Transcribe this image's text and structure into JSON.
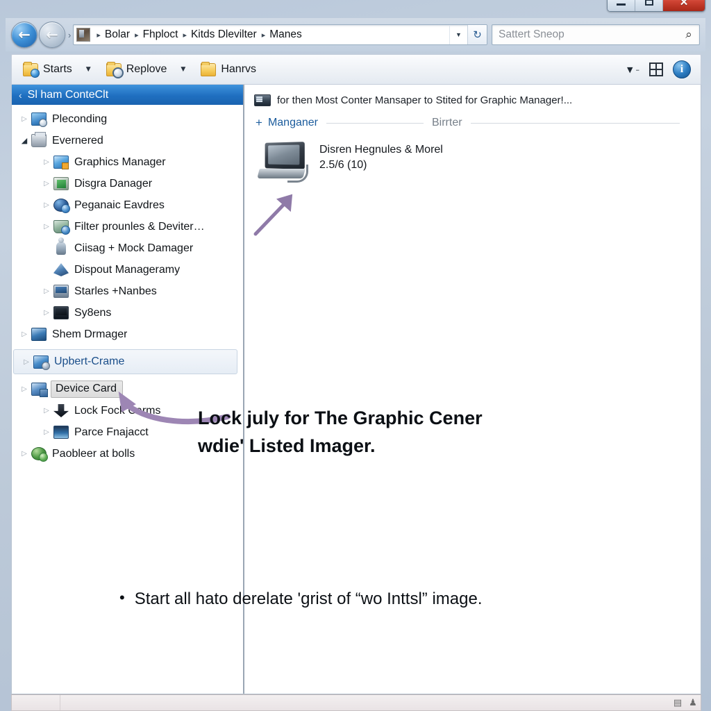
{
  "window": {
    "caption_buttons": [
      {
        "name": "minimize",
        "glyph": ""
      },
      {
        "name": "maximize",
        "glyph": ""
      },
      {
        "name": "close",
        "glyph": "✕"
      }
    ]
  },
  "navbar": {
    "back_arrow": "←",
    "forward_arrow": "←",
    "recent_chevron": "›",
    "breadcrumb": {
      "separator": "▸",
      "crumbs": [
        "Bolar",
        "Fhploct",
        "Kitds Dlevilter",
        "Manes"
      ]
    },
    "dropdown_caret": "▼",
    "refresh_glyph": "↻",
    "search": {
      "placeholder": "Sattert Sneop",
      "value": "",
      "icon": "search-icon",
      "magnifier_glyph": "⌕"
    }
  },
  "toolbar": {
    "items": [
      {
        "label": "Starts",
        "icon": "folder-badge-icon",
        "caret": "▼"
      },
      {
        "label": "Replove",
        "icon": "folder-blue-badge-icon",
        "caret": "▼"
      },
      {
        "label": "Hanrvs",
        "icon": "folder-icon",
        "caret": ""
      }
    ],
    "view_caret": "▼",
    "view_dash": "–",
    "grid_icon": "grid-view-icon",
    "help_icon": "info-icon",
    "help_glyph": "i"
  },
  "sidebar": {
    "header": {
      "chevron": "‹",
      "title": "Sl ham ConteClt"
    },
    "items": [
      {
        "label": "Pleconding",
        "indent": 0,
        "twisty": "▷",
        "expanded": false,
        "icon": "network-icon",
        "state": "normal"
      },
      {
        "label": "Evernered",
        "indent": 0,
        "twisty": "◢",
        "expanded": true,
        "icon": "printer-icon",
        "state": "normal"
      },
      {
        "label": "Graphics Manager",
        "indent": 1,
        "twisty": "▷",
        "expanded": false,
        "icon": "graphics-icon",
        "state": "normal"
      },
      {
        "label": "Disgra Danager",
        "indent": 1,
        "twisty": "▷",
        "expanded": false,
        "icon": "green-card-icon",
        "state": "normal"
      },
      {
        "label": "Peganaic Eavdres",
        "indent": 1,
        "twisty": "▷",
        "expanded": false,
        "icon": "globe-icon",
        "state": "normal"
      },
      {
        "label": "Filter prounles & Deviter…",
        "indent": 1,
        "twisty": "▷",
        "expanded": false,
        "icon": "filter-icon",
        "state": "normal"
      },
      {
        "label": "Ciisag + Mock Damager",
        "indent": 1,
        "twisty": "",
        "expanded": false,
        "icon": "person-icon",
        "state": "normal"
      },
      {
        "label": "Dispout Manageramy",
        "indent": 1,
        "twisty": "",
        "expanded": false,
        "icon": "display-icon",
        "state": "normal"
      },
      {
        "label": "Starles +Nanbes",
        "indent": 1,
        "twisty": "▷",
        "expanded": false,
        "icon": "laptop-icon",
        "state": "normal"
      },
      {
        "label": "Sy8ens",
        "indent": 1,
        "twisty": "▷",
        "expanded": false,
        "icon": "monitor-icon",
        "state": "normal"
      },
      {
        "label": "Shem Drmager",
        "indent": 0,
        "twisty": "▷",
        "expanded": false,
        "icon": "screen-icon",
        "state": "normal"
      },
      {
        "label": "Upbert-Crame",
        "indent": 0,
        "twisty": "▷",
        "expanded": false,
        "icon": "flag-icon",
        "state": "soft-selected"
      },
      {
        "label": "Device Card",
        "indent": 0,
        "twisty": "▷",
        "expanded": true,
        "icon": "device-card-icon",
        "state": "selected"
      },
      {
        "label": "Lock Fock Carms",
        "indent": 1,
        "twisty": "▷",
        "expanded": false,
        "icon": "download-icon",
        "state": "normal"
      },
      {
        "label": "Parce Fnajacct",
        "indent": 1,
        "twisty": "▷",
        "expanded": false,
        "icon": "picture-icon",
        "state": "normal"
      },
      {
        "label": "Paobleer at bolls",
        "indent": 0,
        "twisty": "▷",
        "expanded": false,
        "icon": "green-globe-icon",
        "state": "normal"
      }
    ]
  },
  "main": {
    "notice": {
      "icon": "device-strip-icon",
      "text": "for then Most Conter Mansaper to Stited for Graphic Manager!..."
    },
    "groups": [
      {
        "plus": "+",
        "title": "Manganer",
        "muted": false
      },
      {
        "plus": "",
        "title": "Birrter",
        "muted": true
      }
    ],
    "device": {
      "icon": "computer-icon",
      "name": "Disren Hegnules & Morel",
      "detail": "2.5/6 (10)"
    }
  },
  "annotations": {
    "arrow_color": "#8f7aa8",
    "headline_line1": "Lock july for The Graphic Cener",
    "headline_line2": "wdie' Listed Imager.",
    "bullet_dot": "•",
    "bullet_text": "Start all hato derelate 'grist of “wo Inttsl” image."
  },
  "statusbar": {
    "text": "",
    "icons": [
      "panel-icon",
      "person-icon"
    ],
    "glyphs": [
      "▤",
      "♟"
    ]
  },
  "colors": {
    "accent_blue": "#1f6fc0",
    "frame": "#b9c8da",
    "annotation_purple": "#8f7aa8",
    "close_red": "#cf4433"
  }
}
